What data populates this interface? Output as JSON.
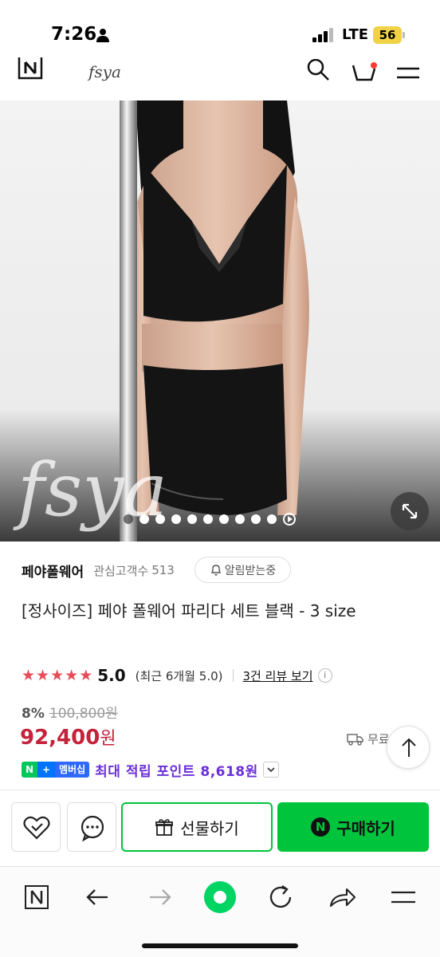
{
  "status": {
    "time": "7:26",
    "network": "LTE",
    "battery": "56"
  },
  "header": {
    "logo": "fsya"
  },
  "product": {
    "watermark": "fsya",
    "carousel_count": 10,
    "active_index": 0
  },
  "store": {
    "name": "페야폴웨어",
    "follower_label": "관심고객수",
    "follower_count": "513",
    "alert_label": "알림받는중"
  },
  "title": "[정사이즈] 페야 폴웨어 파리다 세트 블랙 - 3 size",
  "rating": {
    "value": "5.0",
    "period_text": "(최근 6개월 5.0)",
    "review_link": "3건 리뷰 보기",
    "stars": 5
  },
  "price": {
    "discount_rate": "8%",
    "original": "100,800원",
    "sale": "92,400",
    "sale_unit": "원",
    "shipping": "무료"
  },
  "membership": {
    "badge_n": "N",
    "badge_plus": "+",
    "badge_label": "멤버십",
    "points_text": "최대 적립 포인트 8,618원"
  },
  "actions": {
    "gift_label": "선물하기",
    "buy_label": "구매하기",
    "buy_badge": "N"
  },
  "colors": {
    "accent_green": "#00c43b",
    "price_red": "#c5223b",
    "points_purple": "#6a2fd8"
  }
}
